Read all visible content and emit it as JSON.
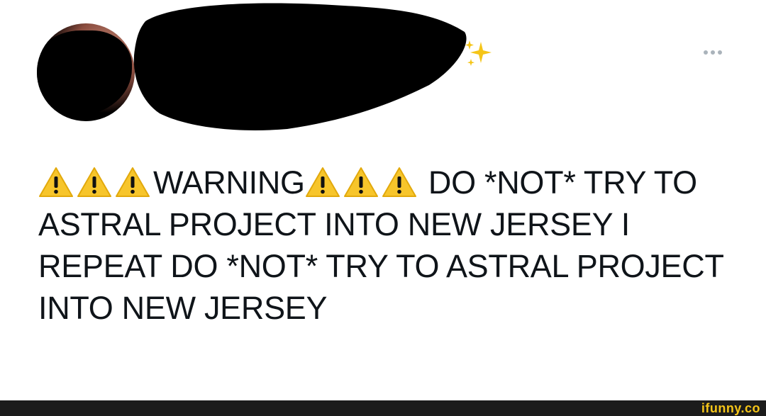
{
  "post": {
    "text_prefix": "WARNING",
    "text_mid": " DO *NOT* TRY TO ASTRAL PROJECT INTO NEW JERSEY I REPEAT DO *NOT* TRY TO ASTRAL PROJECT INTO NEW JERSEY",
    "warning_icon": "warning-icon",
    "sparkle_icon": "sparkles-icon",
    "more_icon": "more-horizontal-icon"
  },
  "watermark": {
    "text": "ifunny.co"
  },
  "colors": {
    "text": "#0f1419",
    "warning_yellow": "#f7c52b",
    "watermark": "#f5c518"
  }
}
